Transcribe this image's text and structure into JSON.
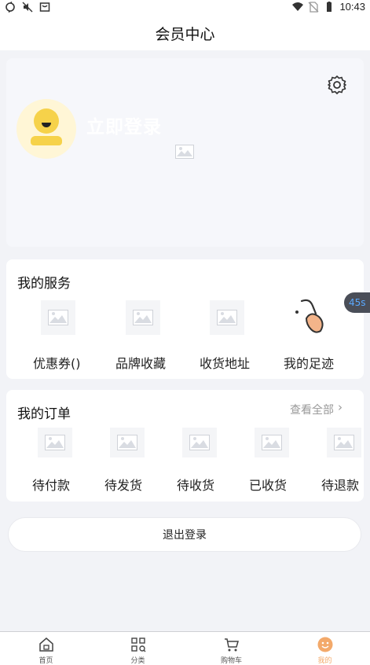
{
  "statusbar": {
    "time": "10:43"
  },
  "header": {
    "title": "会员中心"
  },
  "profile": {
    "login_text": "立即登录"
  },
  "services": {
    "title": "我的服务",
    "items": [
      {
        "label": "优惠券()"
      },
      {
        "label": "品牌收藏"
      },
      {
        "label": "收货地址"
      },
      {
        "label": "我的足迹"
      }
    ]
  },
  "orders": {
    "title": "我的订单",
    "view_all": "查看全部",
    "items": [
      {
        "label": "待付款"
      },
      {
        "label": "待发货"
      },
      {
        "label": "待收货"
      },
      {
        "label": "已收货"
      },
      {
        "label": "待退款"
      }
    ]
  },
  "logout_label": "退出登录",
  "timer_badge": "45s",
  "tabbar": {
    "items": [
      {
        "label": "首页"
      },
      {
        "label": "分类"
      },
      {
        "label": "购物车"
      },
      {
        "label": "我的"
      }
    ]
  },
  "colors": {
    "accent": "#f3a96a",
    "avatar_yellow": "#f6d24a",
    "badge_blue": "#5aa9ff"
  }
}
